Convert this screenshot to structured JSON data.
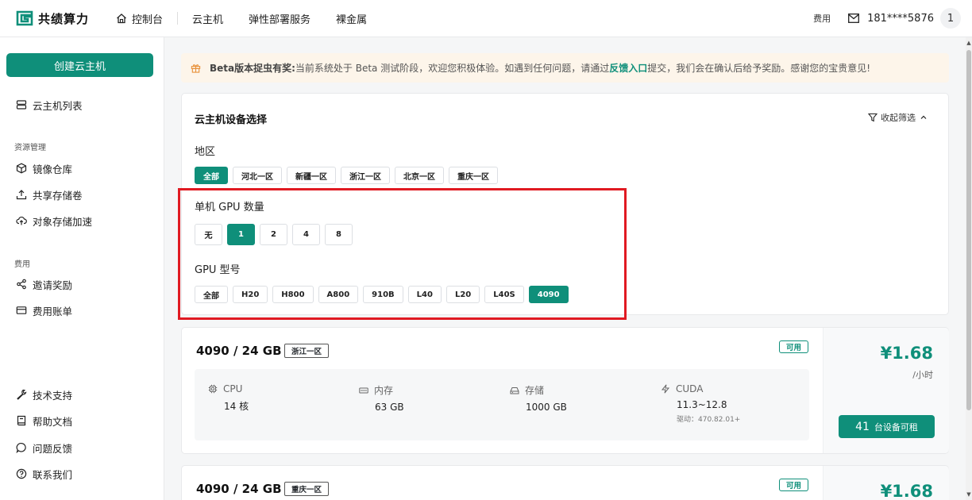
{
  "brand": {
    "name": "共绩算力"
  },
  "nav": [
    {
      "label": "控制台"
    },
    {
      "label": "云主机"
    },
    {
      "label": "弹性部署服务"
    },
    {
      "label": "裸金属"
    }
  ],
  "header": {
    "fee": "费用",
    "phone": "181****5876",
    "avatar": "1"
  },
  "sidebar": {
    "create": "创建云主机",
    "vm_list": "云主机列表",
    "group_resource": "资源管理",
    "image_repo": "镜像仓库",
    "shared_storage": "共享存储卷",
    "object_storage": "对象存储加速",
    "group_fee": "费用",
    "invite": "邀请奖励",
    "bill": "费用账单",
    "support": "技术支持",
    "docs": "帮助文档",
    "feedback": "问题反馈",
    "contact": "联系我们"
  },
  "banner": {
    "title": "Beta版本捉虫有奖:",
    "text1": "当前系统处于 Beta 测试阶段，欢迎您积极体验。如遇到任何问题，请通过",
    "link": "反馈入口",
    "text2": "提交，我们会在确认后给予奖励。感谢您的宝贵意见!"
  },
  "filter": {
    "title": "云主机设备选择",
    "collapse": "收起筛选",
    "region_label": "地区",
    "regions": [
      "全部",
      "河北一区",
      "新疆一区",
      "浙江一区",
      "北京一区",
      "重庆一区"
    ],
    "gpu_count_label": "单机 GPU 数量",
    "gpu_counts": [
      "无",
      "1",
      "2",
      "4",
      "8"
    ],
    "gpu_model_label": "GPU 型号",
    "gpu_models": [
      "全部",
      "H20",
      "H800",
      "A800",
      "910B",
      "L40",
      "L20",
      "L40S",
      "4090"
    ]
  },
  "cards": [
    {
      "title": "4090 / 24 GB",
      "region": "浙江一区",
      "status": "可用",
      "cpu_label": "CPU",
      "cpu": "14 核",
      "mem_label": "内存",
      "mem": "63 GB",
      "disk_label": "存储",
      "disk": "1000 GB",
      "cuda_label": "CUDA",
      "cuda": "11.3~12.8",
      "driver": "驱动：470.82.01+",
      "price": "¥1.68",
      "per": "/小时",
      "count": "41",
      "rent": "台设备可租"
    },
    {
      "title": "4090 / 24 GB",
      "region": "重庆一区",
      "status": "可用",
      "price": "¥1.68"
    }
  ]
}
